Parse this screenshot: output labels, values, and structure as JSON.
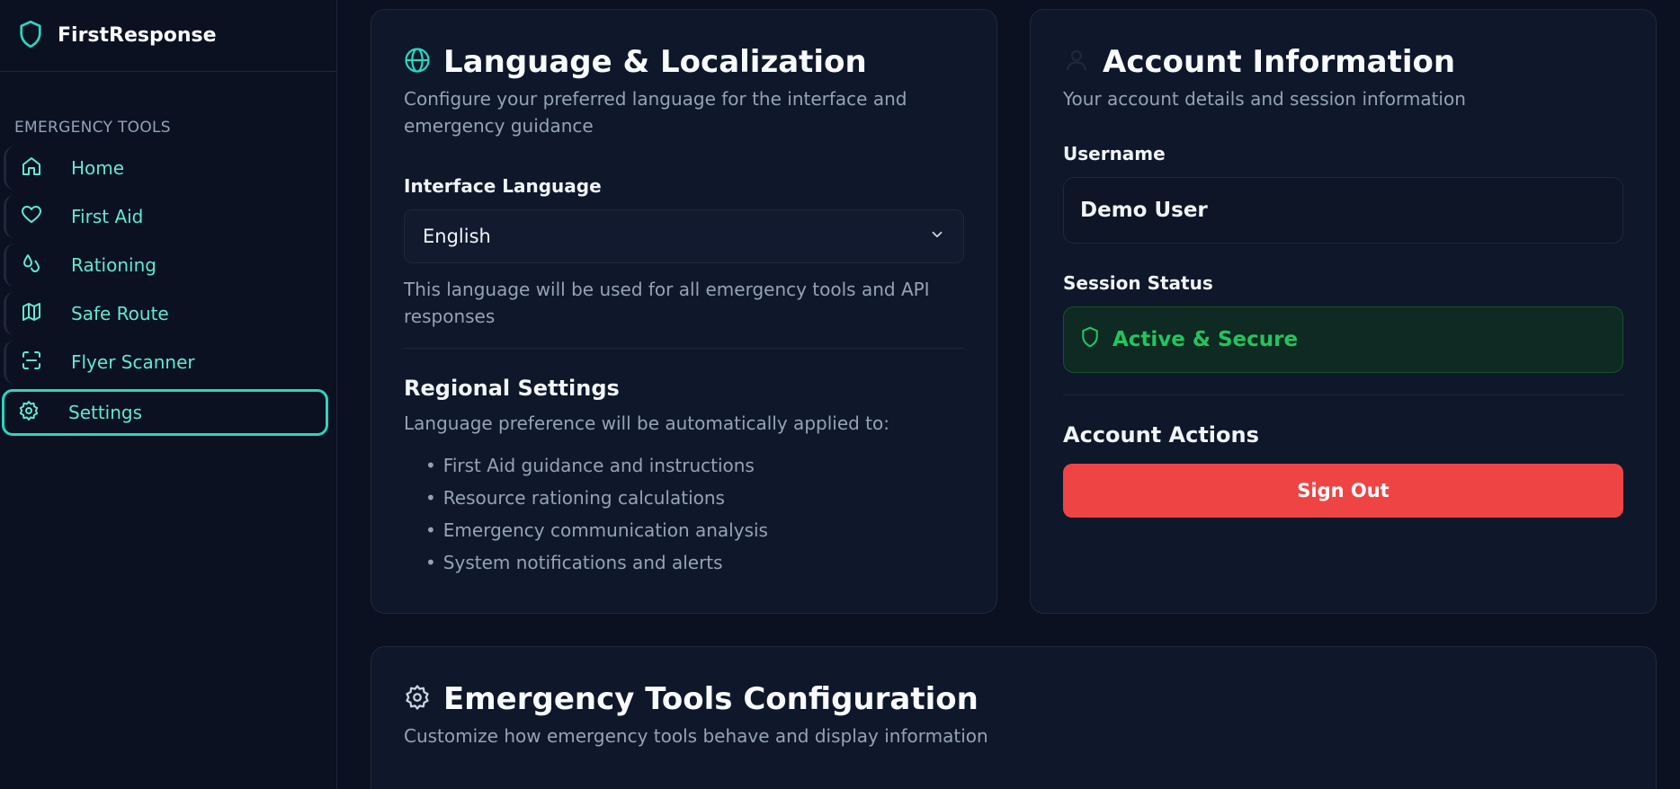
{
  "app": {
    "name": "FirstResponse"
  },
  "sidebar": {
    "section_title": "EMERGENCY TOOLS",
    "items": [
      {
        "label": "Home",
        "icon": "home-icon"
      },
      {
        "label": "First Aid",
        "icon": "heart-icon"
      },
      {
        "label": "Rationing",
        "icon": "droplets-icon"
      },
      {
        "label": "Safe Route",
        "icon": "map-icon"
      },
      {
        "label": "Flyer Scanner",
        "icon": "scan-icon"
      },
      {
        "label": "Settings",
        "icon": "gear-icon",
        "active": true
      }
    ]
  },
  "language_card": {
    "title": "Language & Localization",
    "subtitle": "Configure your preferred language for the interface and emergency guidance",
    "interface_language_label": "Interface Language",
    "selected_language": "English",
    "hint": "This language will be used for all emergency tools and API responses",
    "regional_title": "Regional Settings",
    "regional_intro": "Language preference will be automatically applied to:",
    "regional_items": [
      "First Aid guidance and instructions",
      "Resource rationing calculations",
      "Emergency communication analysis",
      "System notifications and alerts"
    ]
  },
  "account_card": {
    "title": "Account Information",
    "subtitle": "Your account details and session information",
    "username_label": "Username",
    "username": "Demo User",
    "session_label": "Session Status",
    "session_status": "Active & Secure",
    "actions_title": "Account Actions",
    "sign_out": "Sign Out"
  },
  "tools_card": {
    "title": "Emergency Tools Configuration",
    "subtitle": "Customize how emergency tools behave and display information"
  },
  "colors": {
    "accent": "#2dd4bf",
    "danger": "#ef4444",
    "success": "#22c55e",
    "background": "#0b1120",
    "card": "#0f172a"
  }
}
